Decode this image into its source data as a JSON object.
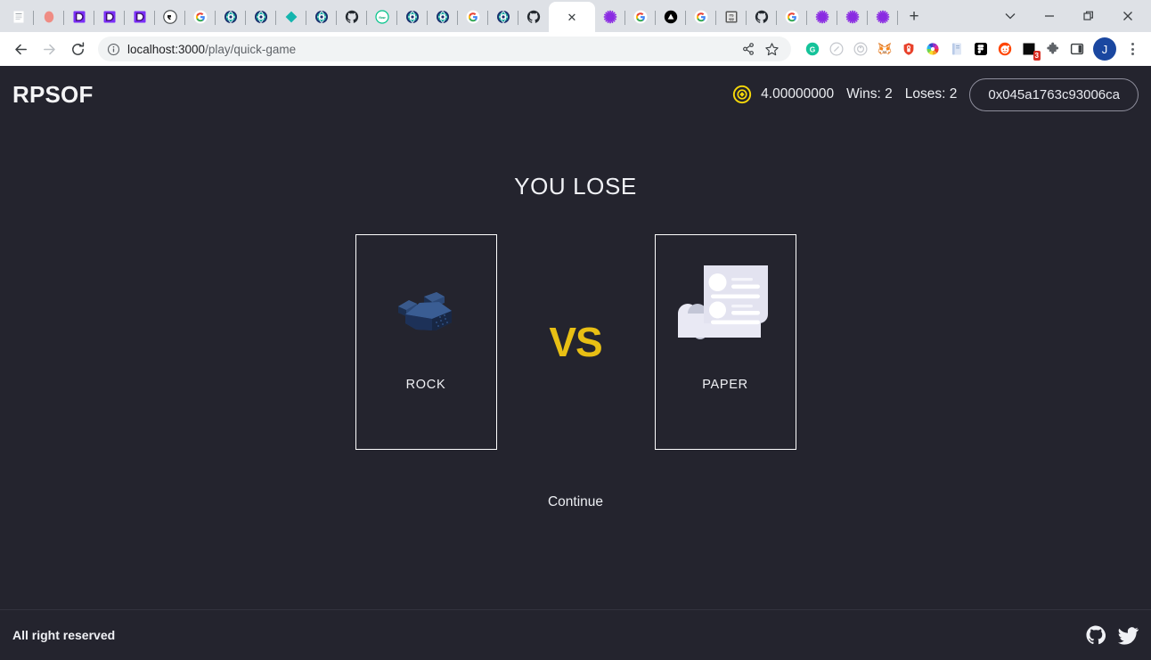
{
  "browser": {
    "tabs": [
      {
        "name": "tab-doc",
        "icon": "document-icon"
      },
      {
        "name": "tab-pink-blob",
        "icon": "pink-blob-icon"
      },
      {
        "name": "tab-dev-1",
        "icon": "dev-purple-icon"
      },
      {
        "name": "tab-dev-2",
        "icon": "dev-purple-icon"
      },
      {
        "name": "tab-dev-3",
        "icon": "dev-purple-icon"
      },
      {
        "name": "tab-ghost",
        "icon": "ghost-badge-icon"
      },
      {
        "name": "tab-google-1",
        "icon": "google-icon"
      },
      {
        "name": "tab-globe-1",
        "icon": "teal-globe-icon"
      },
      {
        "name": "tab-globe-2",
        "icon": "teal-globe-icon"
      },
      {
        "name": "tab-diamond",
        "icon": "teal-diamond-icon"
      },
      {
        "name": "tab-globe-3",
        "icon": "teal-globe-icon"
      },
      {
        "name": "tab-github-1",
        "icon": "github-icon"
      },
      {
        "name": "tab-flow",
        "icon": "flow-circle-icon"
      },
      {
        "name": "tab-globe-4",
        "icon": "teal-globe-icon"
      },
      {
        "name": "tab-globe-5",
        "icon": "teal-globe-icon"
      },
      {
        "name": "tab-google-2",
        "icon": "google-icon"
      },
      {
        "name": "tab-globe-6",
        "icon": "teal-globe-icon"
      },
      {
        "name": "tab-github-2",
        "icon": "github-icon"
      }
    ],
    "active_tab": {
      "name": "tab-active-quick-game",
      "close_glyph": "✕"
    },
    "tabs_after": [
      {
        "name": "tab-asterisk-1",
        "icon": "purple-asterisk-icon"
      },
      {
        "name": "tab-google-3",
        "icon": "google-icon"
      },
      {
        "name": "tab-triangle",
        "icon": "black-triangle-icon"
      },
      {
        "name": "tab-google-4",
        "icon": "google-icon"
      },
      {
        "name": "tab-its-app",
        "icon": "its-app-icon"
      },
      {
        "name": "tab-github-3",
        "icon": "github-icon"
      },
      {
        "name": "tab-google-5",
        "icon": "google-icon"
      },
      {
        "name": "tab-asterisk-2",
        "icon": "purple-asterisk-icon"
      },
      {
        "name": "tab-asterisk-3",
        "icon": "purple-asterisk-icon"
      },
      {
        "name": "tab-asterisk-4",
        "icon": "purple-asterisk-icon"
      }
    ],
    "new_tab_glyph": "+",
    "window_controls": {
      "tab_search_glyph": "⌄",
      "minimize_glyph": "–",
      "maximize_glyph": "❐",
      "close_glyph": "✕"
    },
    "nav": {
      "back_glyph": "←",
      "forward_glyph": "→",
      "reload_glyph": "⟳"
    },
    "omnibox": {
      "site_info_icon": "info-circle-icon",
      "url_host": "localhost:3000",
      "url_path": "/play/quick-game",
      "share_icon": "share-icon",
      "bookmark_icon": "star-icon"
    },
    "extensions": [
      {
        "name": "ext-grammarly",
        "icon": "grammarly-icon"
      },
      {
        "name": "ext-compass",
        "icon": "compass-grey-icon"
      },
      {
        "name": "ext-target",
        "icon": "target-grey-icon"
      },
      {
        "name": "ext-metamask",
        "icon": "metamask-fox-icon"
      },
      {
        "name": "ext-keeper",
        "icon": "keeper-lock-icon"
      },
      {
        "name": "ext-colorpicker",
        "icon": "color-wheel-icon"
      },
      {
        "name": "ext-notebook",
        "icon": "notebook-icon"
      },
      {
        "name": "ext-figma",
        "icon": "figma-icon"
      },
      {
        "name": "ext-reddit",
        "icon": "reddit-icon"
      },
      {
        "name": "ext-black-square",
        "icon": "black-square-icon",
        "badge": "3"
      },
      {
        "name": "ext-puzzle",
        "icon": "puzzle-piece-icon"
      },
      {
        "name": "ext-sidepanel",
        "icon": "side-panel-icon"
      }
    ],
    "profile_initial": "J",
    "menu_icon": "three-dots-icon"
  },
  "app": {
    "brand": "RPSOF",
    "header": {
      "token_icon": "coin-token-icon",
      "balance": "4.00000000",
      "wins_label": "Wins: 2",
      "loses_label": "Loses: 2",
      "wallet_address": "0x045a1763c93006ca"
    },
    "main": {
      "result_title": "YOU LOSE",
      "player_card": {
        "label": "ROCK",
        "art": "rock-3d-icon"
      },
      "vs_label": "VS",
      "opponent_card": {
        "label": "PAPER",
        "art": "paper-document-icon"
      },
      "continue_label": "Continue"
    },
    "footer": {
      "copyright": "All right reserved",
      "links": [
        {
          "name": "github-link",
          "icon": "github-icon"
        },
        {
          "name": "twitter-link",
          "icon": "twitter-icon"
        }
      ]
    },
    "colors": {
      "background": "#24242e",
      "accent_yellow": "#e8bf14",
      "text": "#f0f1f5",
      "rock_blue": "#2c4770",
      "paper_white": "#e6e6f0"
    }
  }
}
